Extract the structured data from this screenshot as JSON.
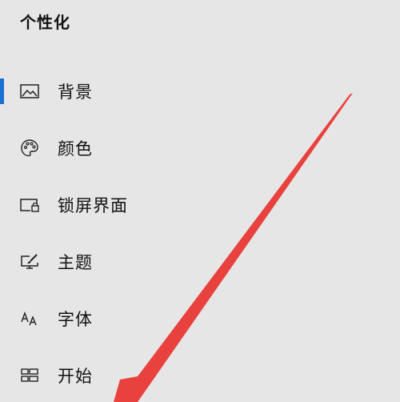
{
  "header": {
    "title": "个性化"
  },
  "nav": {
    "items": [
      {
        "label": "背景",
        "icon": "picture-icon",
        "selected": true
      },
      {
        "label": "颜色",
        "icon": "palette-icon",
        "selected": false
      },
      {
        "label": "锁屏界面",
        "icon": "lock-screen-icon",
        "selected": false
      },
      {
        "label": "主题",
        "icon": "theme-brush-icon",
        "selected": false
      },
      {
        "label": "字体",
        "icon": "font-icon",
        "selected": false
      },
      {
        "label": "开始",
        "icon": "start-tiles-icon",
        "selected": false
      }
    ]
  },
  "colors": {
    "background": "#e6e6e6",
    "accent": "#1b6fd1",
    "annotation_arrow": "#e8413e"
  }
}
